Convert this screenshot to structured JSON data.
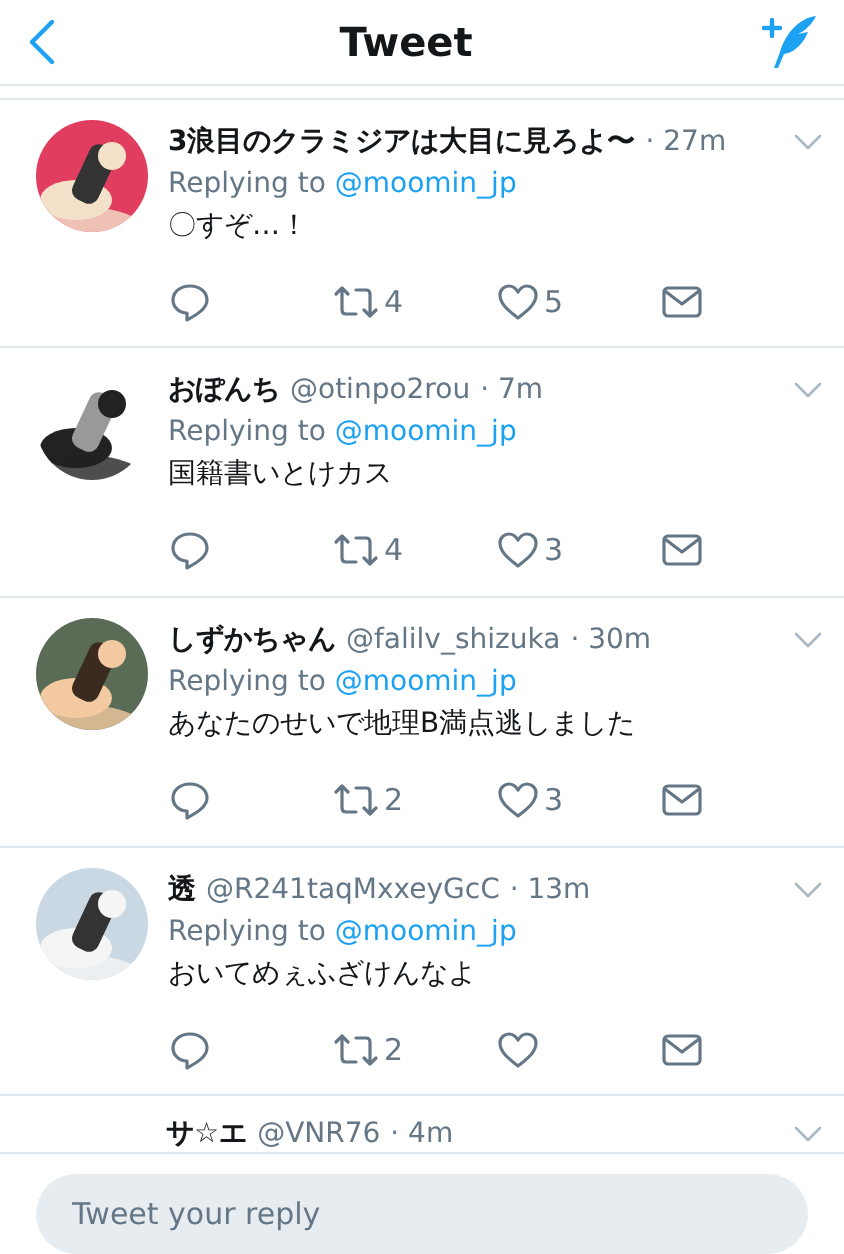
{
  "header": {
    "title": "Tweet"
  },
  "tweets": [
    {
      "name": "3浪目のクラミジアは大目に見ろよ〜",
      "time": "· 27m",
      "replying_label": "Replying to",
      "replying_to": "@moomin_jp",
      "text": "〇すぞ…！",
      "retweets": "4",
      "likes": "5"
    },
    {
      "name": "おぽんち",
      "handle": "@otinpo2rou",
      "time": "· 7m",
      "replying_label": "Replying to",
      "replying_to": "@moomin_jp",
      "text": "国籍書いとけカス",
      "retweets": "4",
      "likes": "3"
    },
    {
      "name": "しずかちゃん",
      "handle": "@falilv_shizuka",
      "time": "· 30m",
      "replying_label": "Replying to",
      "replying_to": "@moomin_jp",
      "text": "あなたのせいで地理B満点逃しました",
      "retweets": "2",
      "likes": "3"
    },
    {
      "name": "透",
      "handle": "@R241taqMxxeyGcC",
      "time": "· 13m",
      "replying_label": "Replying to",
      "replying_to": "@moomin_jp",
      "text": "おいてめぇふざけんなよ",
      "retweets": "2"
    }
  ],
  "partial_tweet": {
    "name": "サ☆エ",
    "handle": "@VNR76",
    "time": "· 4m"
  },
  "reply_bar": {
    "placeholder": "Tweet your reply"
  }
}
